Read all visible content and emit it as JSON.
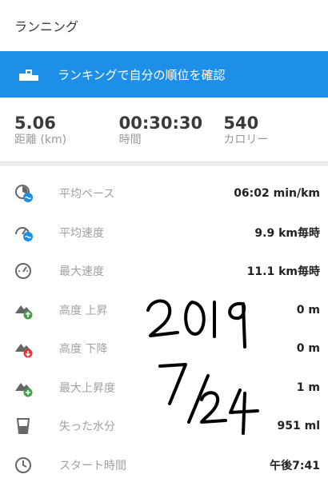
{
  "app_bar": {
    "title": "ランニング"
  },
  "banner": {
    "label": "ランキングで自分の順位を確認",
    "color": "#1e8fe6"
  },
  "summary": [
    {
      "value": "5.06",
      "label": "距離 (km)"
    },
    {
      "value": "00:30:30",
      "label": "時間"
    },
    {
      "value": "540",
      "label": "カロリー"
    }
  ],
  "details": [
    {
      "icon": "avg-pace-icon",
      "name": "平均ペース",
      "value": "06:02 min/km"
    },
    {
      "icon": "avg-speed-icon",
      "name": "平均速度",
      "value": "9.9 km毎時"
    },
    {
      "icon": "max-speed-icon",
      "name": "最大速度",
      "value": "11.1 km毎時"
    },
    {
      "icon": "elevation-gain-icon",
      "name": "高度 上昇",
      "value": "0 m"
    },
    {
      "icon": "elevation-loss-icon",
      "name": "高度 下降",
      "value": "0 m"
    },
    {
      "icon": "max-elevation-icon",
      "name": "最大上昇度",
      "value": "1 m"
    },
    {
      "icon": "water-glass-icon",
      "name": "失った水分",
      "value": "951 ml"
    },
    {
      "icon": "clock-icon",
      "name": "スタート時間",
      "value": "午後7:41"
    }
  ]
}
